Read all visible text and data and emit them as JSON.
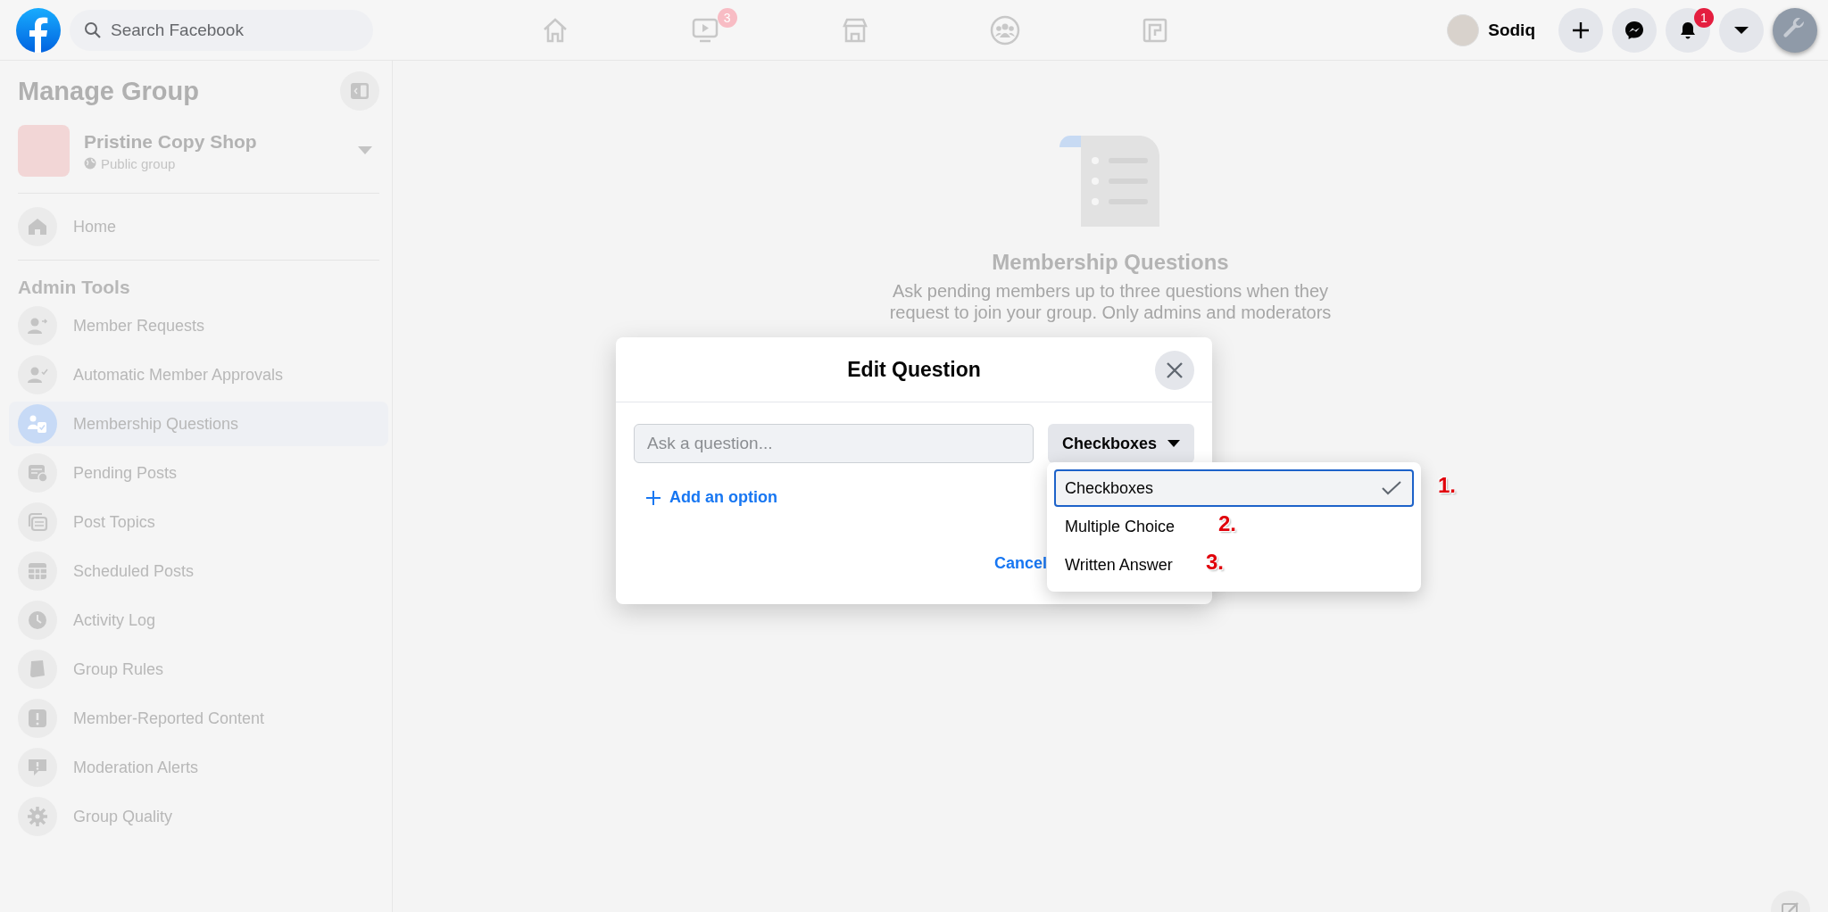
{
  "topbar": {
    "search": {
      "placeholder": "Search Facebook"
    },
    "nav": [
      {
        "kind": "home"
      },
      {
        "kind": "video",
        "badge": "3"
      },
      {
        "kind": "store"
      },
      {
        "kind": "groups"
      },
      {
        "kind": "gaming"
      }
    ],
    "profile": {
      "name": "Sodiq"
    },
    "actions": [
      {
        "kind": "plus"
      },
      {
        "kind": "messenger"
      },
      {
        "kind": "bell",
        "badge": "1"
      },
      {
        "kind": "caret"
      },
      {
        "kind": "wrench"
      }
    ]
  },
  "sidebar": {
    "title": "Manage Group",
    "group": {
      "name": "Pristine Copy Shop",
      "privacy": "Public group"
    },
    "home": {
      "label": "Home"
    },
    "section": "Admin Tools",
    "items": [
      {
        "label": "Member Requests",
        "kind": "person-add",
        "selected": false
      },
      {
        "label": "Automatic Member Approvals",
        "kind": "person-check",
        "selected": false
      },
      {
        "label": "Membership Questions",
        "kind": "questions",
        "selected": true
      },
      {
        "label": "Pending Posts",
        "kind": "pending",
        "selected": false
      },
      {
        "label": "Post Topics",
        "kind": "topics",
        "selected": false
      },
      {
        "label": "Scheduled Posts",
        "kind": "calendar",
        "selected": false
      },
      {
        "label": "Activity Log",
        "kind": "clock",
        "selected": false
      },
      {
        "label": "Group Rules",
        "kind": "book",
        "selected": false
      },
      {
        "label": "Member-Reported Content",
        "kind": "alert",
        "selected": false
      },
      {
        "label": "Moderation Alerts",
        "kind": "bubble",
        "selected": false
      },
      {
        "label": "Group Quality",
        "kind": "gear",
        "selected": false
      }
    ]
  },
  "main": {
    "title": "Membership Questions",
    "description": "Ask pending members up to three questions when they request to join your group. Only admins and moderators"
  },
  "modal": {
    "title": "Edit Question",
    "question": {
      "placeholder": "Ask a question..."
    },
    "type_button": "Checkboxes",
    "add_option": "Add an option",
    "cancel": "Cancel"
  },
  "dropdown": {
    "options": [
      {
        "label": "Checkboxes",
        "selected": true,
        "annotation": "1."
      },
      {
        "label": "Multiple Choice",
        "selected": false,
        "annotation": "2."
      },
      {
        "label": "Written Answer",
        "selected": false,
        "annotation": "3."
      }
    ]
  }
}
